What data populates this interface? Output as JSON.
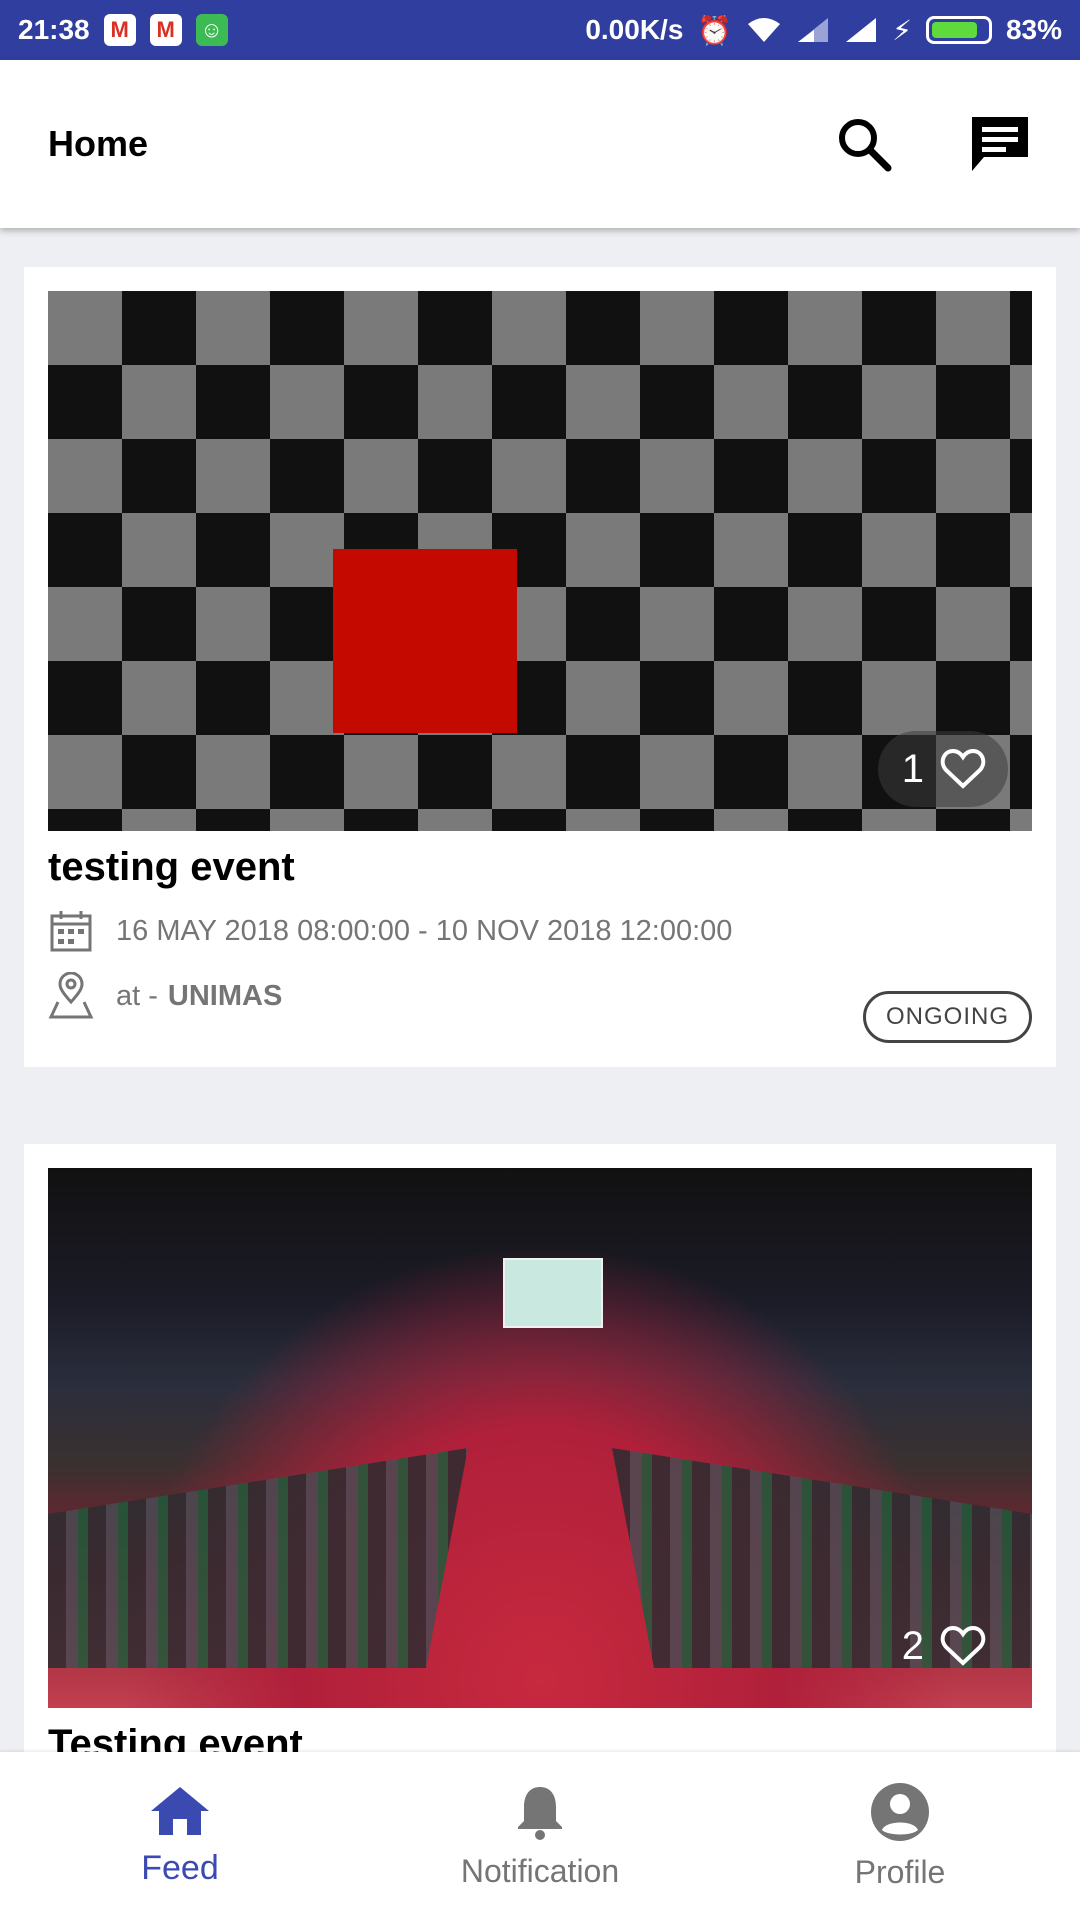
{
  "status_bar": {
    "time": "21:38",
    "speed": "0.00K/s",
    "battery": "83%",
    "icons": [
      "gmail-icon",
      "gmail-icon",
      "android-icon",
      "alarm-icon",
      "wifi-icon",
      "signal-icon",
      "signal-icon",
      "charging-icon",
      "battery-icon"
    ]
  },
  "app_bar": {
    "title": "Home",
    "icons": [
      "search-icon",
      "chat-icon"
    ]
  },
  "cards": [
    {
      "likes": "1",
      "title": "testing event",
      "date_range": "16 MAY 2018 08:00:00 - 10 NOV 2018 12:00:00",
      "location_prefix": "at -",
      "location": "UNIMAS",
      "status": "ONGOING"
    },
    {
      "likes": "2",
      "title": "Testing event"
    }
  ],
  "bottom_nav": {
    "items": [
      {
        "label": "Feed",
        "icon": "home-icon",
        "active": true
      },
      {
        "label": "Notification",
        "icon": "bell-icon",
        "active": false
      },
      {
        "label": "Profile",
        "icon": "account-circle-icon",
        "active": false
      }
    ]
  },
  "colors": {
    "primary": "#303e9f",
    "active_nav": "#3b4ab0",
    "text_secondary": "#757575"
  }
}
